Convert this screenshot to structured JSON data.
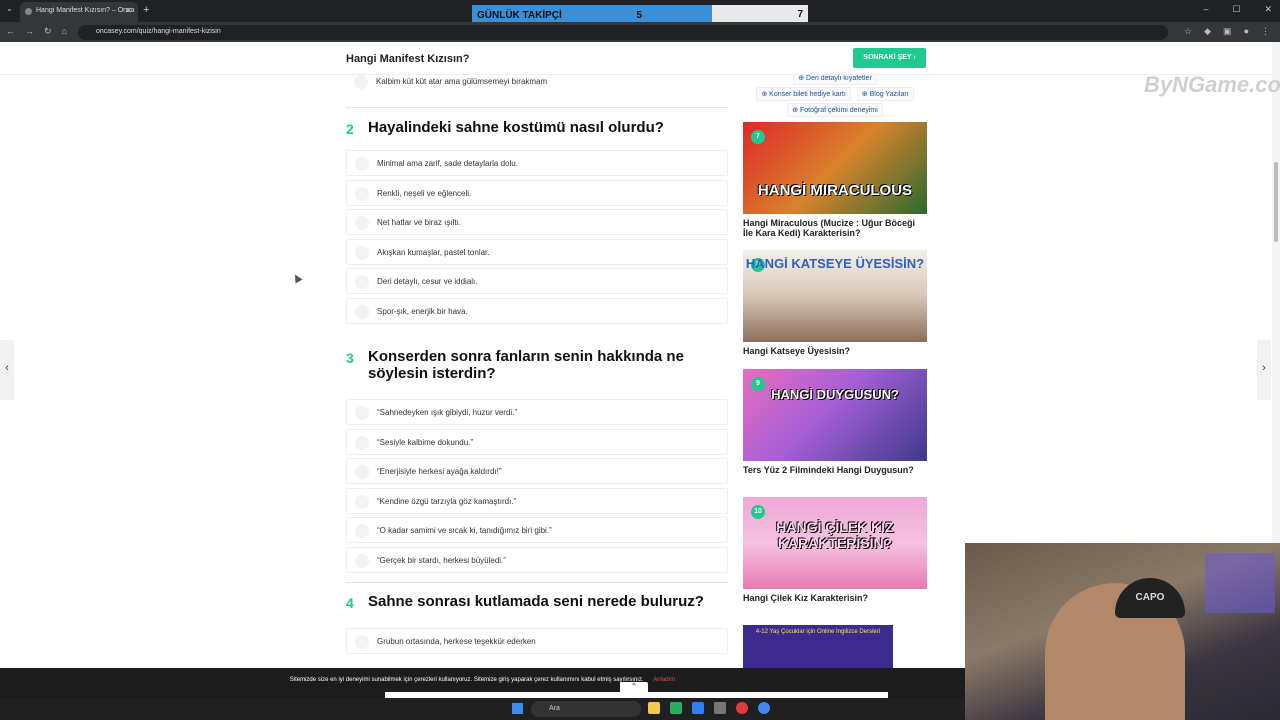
{
  "browser": {
    "tab_title": "Hangi Manifest Kızısın? – Onca",
    "url": "oncasey.com/quiz/hangi-manifest-kizisin"
  },
  "counter": {
    "label": "GÜNLÜK TAKİPÇİ",
    "value": "5",
    "total": "7"
  },
  "site": {
    "header_title": "Hangi Manifest Kızısın?",
    "next_button": "SONRAKİ ŞEY"
  },
  "questions": [
    {
      "partial_answer": "Kalbim küt küt atar ama gülümsemeyi bırakmam"
    },
    {
      "number": "2",
      "title": "Hayalindeki sahne kostümü nasıl olurdu?",
      "answers": [
        "Minimal ama zarif, sade detaylarla dolu.",
        "Renkli, neşeli ve eğlenceli.",
        "Net hatlar ve biraz ışıltı.",
        "Akışkan kumaşlar, pastel tonlar.",
        "Deri detaylı, cesur ve iddialı.",
        "Spor-şık, enerjik bir hava."
      ]
    },
    {
      "number": "3",
      "title": "Konserden sonra fanların senin hakkında ne söylesin isterdin?",
      "answers": [
        "“Sahnedeyken ışık gibiydi, huzur verdi.”",
        "“Sesiyle kalbime dokundu.”",
        "“Enerjisiyle herkesi ayağa kaldırdı!”",
        "“Kendine özgü tarzıyla göz kamaştırdı.”",
        "“O kadar samimi ve sıcak ki, tanıdığımız biri gibi.”",
        "“Gerçek bir stardı, herkesi büyüledi.”"
      ]
    },
    {
      "number": "4",
      "title": "Sahne sonrası kutlamada seni nerede buluruz?",
      "answers": [
        "Grubun ortasında, herkese teşekkür ederken"
      ]
    }
  ],
  "sidebar": {
    "tags": [
      "Deri detaylı kıyafetler",
      "Konser bileti hediye kartı",
      "Blog Yazıları",
      "Fotoğraf çekimi deneyimi"
    ],
    "cards": [
      {
        "badge": "7",
        "image_text": "HANGİ MIRACULOUS",
        "title": "Hangi Miraculous (Mucize : Uğur Böceği İle Kara Kedi) Karakterisin?"
      },
      {
        "badge": "8",
        "image_text": "HANGİ KATSEYE ÜYESİSİN?",
        "title": "Hangi Katseye Üyesisin?"
      },
      {
        "badge": "9",
        "image_text": "HANGİ DUYGUSUN?",
        "title": "Ters Yüz 2 Filmindeki Hangi Duygusun?"
      },
      {
        "badge": "10",
        "image_text": "HANGİ ÇİLEK KIZ KARAKTERİSİN?",
        "title": "Hangi Çilek Kız Karakterisin?"
      }
    ],
    "ad_text": "4-12 Yaş Çocuklar için Online İngilizce Dersleri"
  },
  "watermark": "ByNGame.com",
  "cookie": {
    "text": "Sitemizde size en iyi deneyimi sunabilmek için çerezleri kullanıyoruz. Sitemize giriş yaparak çerez kullanımını kabul etmiş sayılırsınız.",
    "accept": "Anladım"
  },
  "taskbar": {
    "search_placeholder": "Ara"
  },
  "webcam": {
    "hat_text": "CAPO"
  },
  "colors": {
    "accent": "#1fc98f",
    "counter_blue": "#3b8fd6"
  }
}
